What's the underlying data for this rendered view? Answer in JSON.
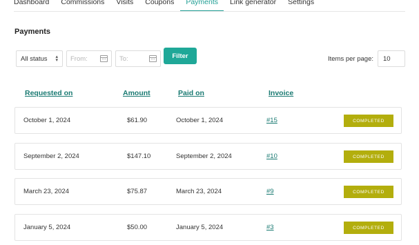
{
  "tabs": [
    {
      "label": "Dashboard"
    },
    {
      "label": "Commissions"
    },
    {
      "label": "Visits"
    },
    {
      "label": "Coupons"
    },
    {
      "label": "Payments",
      "active": true
    },
    {
      "label": "Link generator"
    },
    {
      "label": "Settings"
    }
  ],
  "page": {
    "title": "Payments"
  },
  "filters": {
    "status": "All status",
    "from_placeholder": "From:",
    "to_placeholder": "To:",
    "filter_label": "Filter",
    "items_per_page_label": "Items per page:",
    "items_per_page": "10"
  },
  "table": {
    "headers": {
      "requested_on": "Requested on",
      "amount": "Amount",
      "paid_on": "Paid on",
      "invoice": "Invoice"
    },
    "rows": [
      {
        "requested": "October 1, 2024",
        "amount": "$61.90",
        "paid": "October 1, 2024",
        "invoice": "#15",
        "status": "COMPLETED"
      },
      {
        "requested": "September 2, 2024",
        "amount": "$147.10",
        "paid": "September 2, 2024",
        "invoice": "#10",
        "status": "COMPLETED"
      },
      {
        "requested": "March 23, 2024",
        "amount": "$75.87",
        "paid": "March 23, 2024",
        "invoice": "#9",
        "status": "COMPLETED"
      },
      {
        "requested": "January 5, 2024",
        "amount": "$50.00",
        "paid": "January 5, 2024",
        "invoice": "#3",
        "status": "COMPLETED"
      }
    ]
  },
  "colors": {
    "accent": "#1fa898",
    "link": "#1a7a72",
    "completed_badge": "#b3ae0d"
  },
  "icons": {
    "date_picker": "calendar-icon",
    "select": "chevron-updown-icon"
  }
}
